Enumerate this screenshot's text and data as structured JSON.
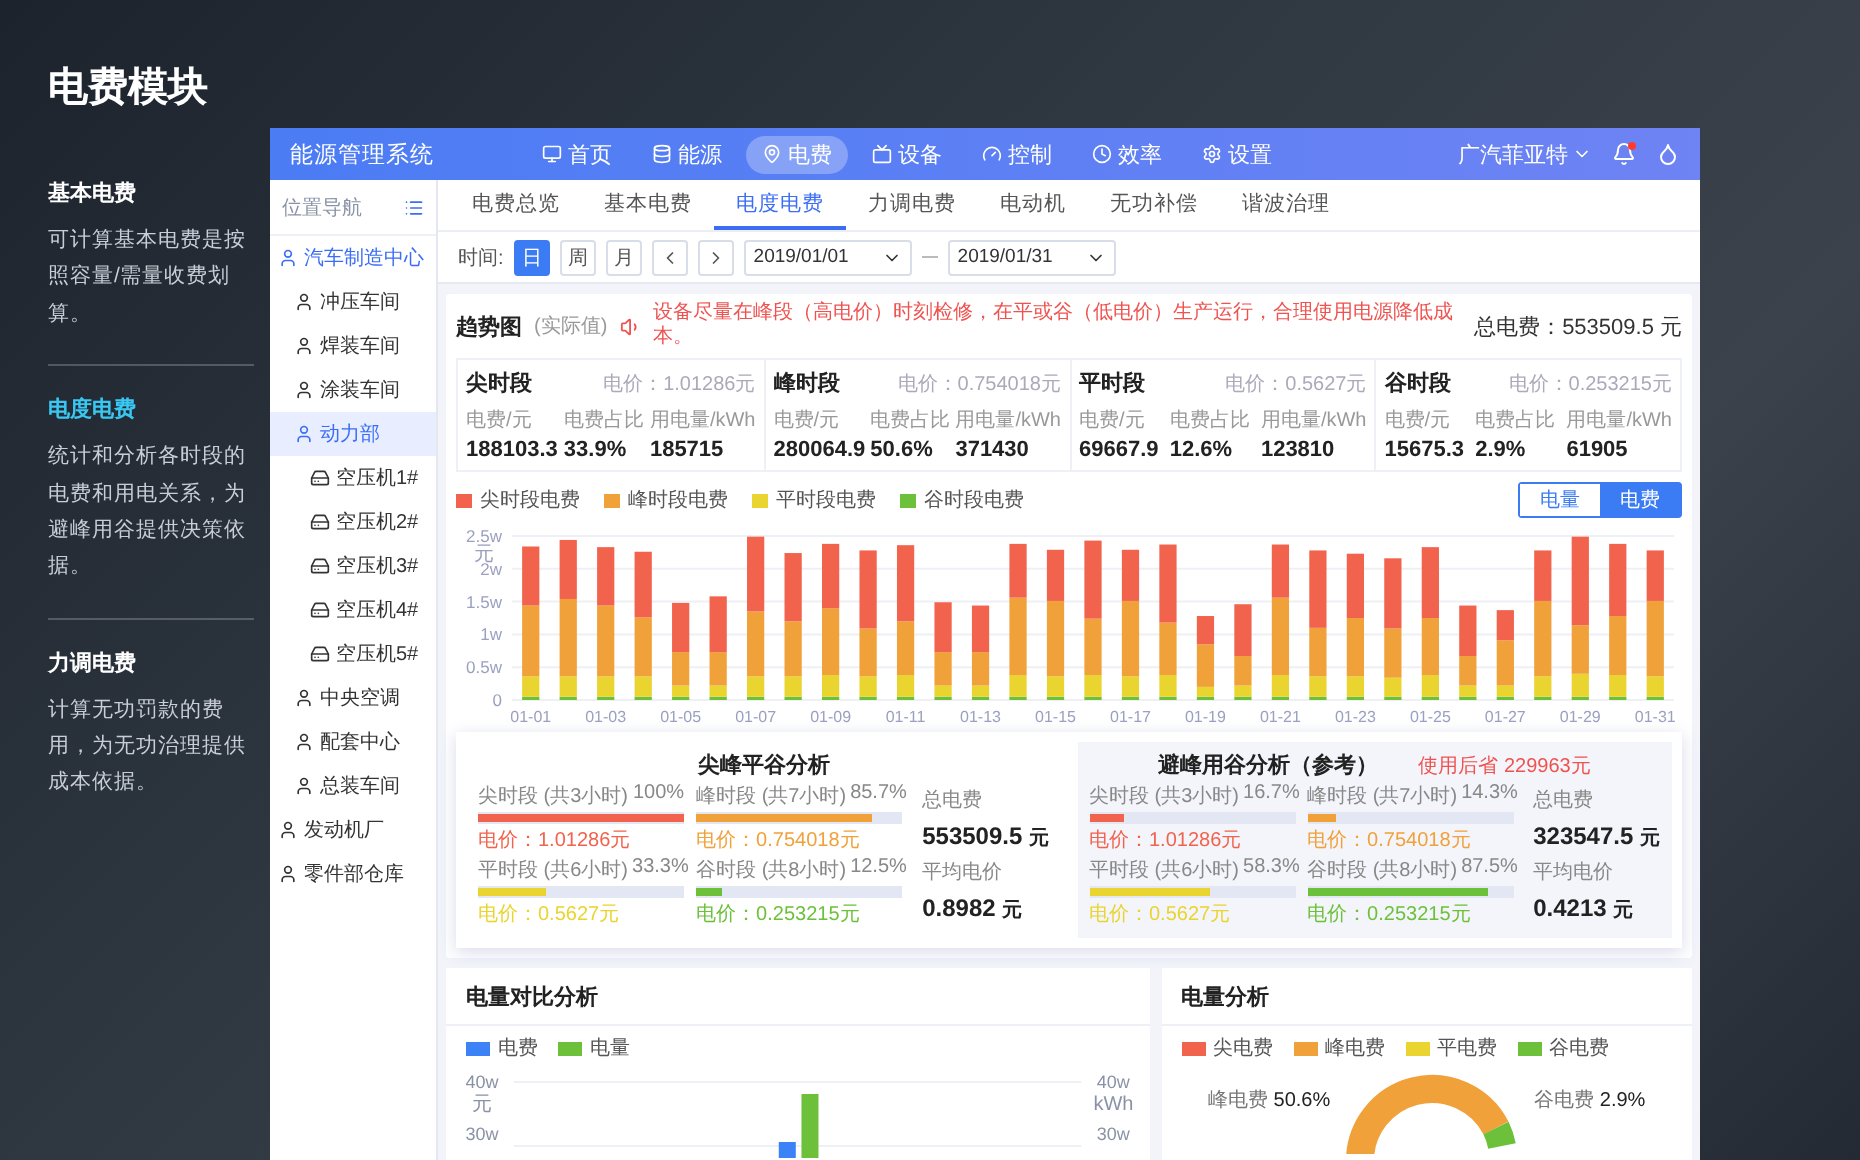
{
  "intro": {
    "title": "电费模块",
    "sections": [
      {
        "title": "基本电费",
        "text": "可计算基本电费是按照容量/需量收费划算。",
        "selected": false
      },
      {
        "title": "电度电费",
        "text": "统计和分析各时段的电费和用电关系，为避峰用谷提供决策依据。",
        "selected": true
      },
      {
        "title": "力调电费",
        "text": "计算无功罚款的费用，为无功治理提供成本依据。",
        "selected": false
      }
    ]
  },
  "app": {
    "title": "能源管理系统",
    "nav": [
      {
        "label": "首页",
        "selected": false
      },
      {
        "label": "能源",
        "selected": false
      },
      {
        "label": "电费",
        "selected": true
      },
      {
        "label": "设备",
        "selected": false
      },
      {
        "label": "控制",
        "selected": false
      },
      {
        "label": "效率",
        "selected": false
      },
      {
        "label": "设置",
        "selected": false
      }
    ],
    "company": "广汽菲亚特",
    "notification": true
  },
  "sidebar": {
    "title": "位置导航",
    "tree": [
      {
        "label": "汽车制造中心",
        "kind": "site",
        "selected": false,
        "active": true,
        "children": [
          {
            "label": "冲压车间",
            "kind": "site",
            "selected": false,
            "active": false
          },
          {
            "label": "焊装车间",
            "kind": "site",
            "selected": false,
            "active": false
          },
          {
            "label": "涂装车间",
            "kind": "site",
            "selected": false,
            "active": false
          },
          {
            "label": "动力部",
            "kind": "site",
            "selected": true,
            "active": true,
            "children": [
              {
                "label": "空压机1#",
                "kind": "device",
                "selected": false,
                "active": false
              },
              {
                "label": "空压机2#",
                "kind": "device",
                "selected": false,
                "active": false
              },
              {
                "label": "空压机3#",
                "kind": "device",
                "selected": false,
                "active": false
              },
              {
                "label": "空压机4#",
                "kind": "device",
                "selected": false,
                "active": false
              },
              {
                "label": "空压机5#",
                "kind": "device",
                "selected": false,
                "active": false
              }
            ]
          },
          {
            "label": "中央空调",
            "kind": "site",
            "selected": false,
            "active": false
          },
          {
            "label": "配套中心",
            "kind": "site",
            "selected": false,
            "active": false
          },
          {
            "label": "总装车间",
            "kind": "site",
            "selected": false,
            "active": false
          }
        ]
      },
      {
        "label": "发动机厂",
        "kind": "site",
        "selected": false,
        "active": false
      },
      {
        "label": "零件部仓库",
        "kind": "site",
        "selected": false,
        "active": false
      }
    ]
  },
  "tabs": [
    {
      "label": "电费总览",
      "selected": false
    },
    {
      "label": "基本电费",
      "selected": false
    },
    {
      "label": "电度电费",
      "selected": true
    },
    {
      "label": "力调电费",
      "selected": false
    },
    {
      "label": "电动机",
      "selected": false
    },
    {
      "label": "无功补偿",
      "selected": false
    },
    {
      "label": "谐波治理",
      "selected": false
    }
  ],
  "time": {
    "label": "时间:",
    "units": [
      {
        "label": "日",
        "selected": true
      },
      {
        "label": "周",
        "selected": false
      },
      {
        "label": "月",
        "selected": false
      }
    ],
    "start": "2019/01/01",
    "end": "2019/01/31"
  },
  "trend": {
    "title": "趋势图",
    "subtitle": "(实际值)",
    "notice": "设备尽量在峰段（高电价）时刻检修，在平或谷（低电价）生产运行，合理使用电源降低成本。",
    "total": "总电费：553509.5 元",
    "periods": [
      {
        "name": "尖时段",
        "price": "电价：1.01286元",
        "metrics": [
          {
            "label": "电费/元",
            "value": "188103.3"
          },
          {
            "label": "电费占比",
            "value": "33.9%"
          },
          {
            "label": "用电量/kWh",
            "value": "185715"
          }
        ]
      },
      {
        "name": "峰时段",
        "price": "电价：0.754018元",
        "metrics": [
          {
            "label": "电费/元",
            "value": "280064.9"
          },
          {
            "label": "电费占比",
            "value": "50.6%"
          },
          {
            "label": "用电量/kWh",
            "value": "371430"
          }
        ]
      },
      {
        "name": "平时段",
        "price": "电价：0.5627元",
        "metrics": [
          {
            "label": "电费/元",
            "value": "69667.9"
          },
          {
            "label": "电费占比",
            "value": "12.6%"
          },
          {
            "label": "用电量/kWh",
            "value": "123810"
          }
        ]
      },
      {
        "name": "谷时段",
        "price": "电价：0.253215元",
        "metrics": [
          {
            "label": "电费/元",
            "value": "15675.3"
          },
          {
            "label": "电费占比",
            "value": "2.9%"
          },
          {
            "label": "用电量/kWh",
            "value": "61905"
          }
        ]
      }
    ],
    "toggle": [
      {
        "label": "电量",
        "selected": false
      },
      {
        "label": "电费",
        "selected": true
      }
    ],
    "chart_data": {
      "type": "bar",
      "stacked": true,
      "grid": true,
      "ylabel": "元",
      "ylim": [
        0,
        2.5
      ],
      "yticks": [
        {
          "value": 0,
          "label": "0"
        },
        {
          "value": 0.5,
          "label": "0.5w"
        },
        {
          "value": 1,
          "label": "1w"
        },
        {
          "value": 1.5,
          "label": "1.5w"
        },
        {
          "value": 2,
          "label": "2w"
        },
        {
          "value": 2.5,
          "label": "2.5w"
        }
      ],
      "categories": [
        "01-01",
        null,
        "01-03",
        null,
        "01-05",
        null,
        "01-07",
        null,
        "01-09",
        null,
        "01-11",
        null,
        "01-13",
        null,
        "01-15",
        null,
        "01-17",
        null,
        "01-19",
        null,
        "01-21",
        null,
        "01-23",
        null,
        "01-25",
        null,
        "01-27",
        null,
        "01-29",
        null,
        "01-31"
      ],
      "series": [
        {
          "name": "尖时段电费",
          "color": "#f2634d",
          "values": [
            0.9,
            0.9,
            0.89,
            1.0,
            0.75,
            0.85,
            1.14,
            1.04,
            0.98,
            1.19,
            1.16,
            0.76,
            0.71,
            0.82,
            0.78,
            1.19,
            0.78,
            1.19,
            0.43,
            0.79,
            0.81,
            1.18,
            0.98,
            1.07,
            1.08,
            0.77,
            0.46,
            0.77,
            1.35,
            1.1,
            0.77
          ]
        },
        {
          "name": "峰时段电费",
          "color": "#f0a13a",
          "values": [
            1.08,
            1.18,
            1.08,
            0.9,
            0.51,
            0.51,
            0.99,
            0.84,
            1.02,
            0.73,
            0.82,
            0.51,
            0.51,
            1.18,
            1.15,
            0.86,
            1.15,
            0.8,
            0.65,
            0.45,
            1.18,
            0.74,
            0.89,
            0.75,
            0.87,
            0.45,
            0.69,
            1.15,
            0.74,
            0.9,
            1.15
          ]
        },
        {
          "name": "平时段电费",
          "color": "#e9d430",
          "values": [
            0.31,
            0.31,
            0.31,
            0.31,
            0.17,
            0.17,
            0.31,
            0.31,
            0.33,
            0.31,
            0.33,
            0.17,
            0.17,
            0.33,
            0.31,
            0.33,
            0.31,
            0.33,
            0.15,
            0.17,
            0.33,
            0.31,
            0.31,
            0.29,
            0.33,
            0.17,
            0.17,
            0.31,
            0.35,
            0.33,
            0.31
          ]
        },
        {
          "name": "谷时段电费",
          "color": "#6dc13a",
          "values": [
            0.05,
            0.05,
            0.05,
            0.05,
            0.05,
            0.05,
            0.05,
            0.05,
            0.05,
            0.05,
            0.05,
            0.05,
            0.05,
            0.05,
            0.05,
            0.05,
            0.05,
            0.05,
            0.05,
            0.05,
            0.05,
            0.05,
            0.05,
            0.05,
            0.05,
            0.05,
            0.05,
            0.05,
            0.05,
            0.05,
            0.05
          ]
        }
      ]
    },
    "analysis": [
      {
        "title": "尖峰平谷分析",
        "items": [
          {
            "name": "尖时段",
            "hours": "(共3小时)",
            "percent": "100%",
            "price": "电价：1.01286元",
            "level": 1,
            "color": "#f2634d"
          },
          {
            "name": "峰时段",
            "hours": "(共7小时)",
            "percent": "85.7%",
            "price": "电价：0.754018元",
            "level": 0.857,
            "color": "#f0a13a"
          },
          {
            "name": "平时段",
            "hours": "(共6小时)",
            "percent": "33.3%",
            "price": "电价：0.5627元",
            "level": 0.333,
            "color": "#e9d430"
          },
          {
            "name": "谷时段",
            "hours": "(共8小时)",
            "percent": "12.5%",
            "price": "电价：0.253215元",
            "level": 0.125,
            "color": "#6dc13a"
          }
        ],
        "totals": [
          {
            "label": "总电费",
            "value": "553509.5",
            "unit": "元"
          },
          {
            "label": "平均电价",
            "value": "0.8982",
            "unit": "元"
          }
        ]
      },
      {
        "title": "避峰用谷分析（参考）",
        "saving": "使用后省 229963元",
        "items": [
          {
            "name": "尖时段",
            "hours": "(共3小时)",
            "percent": "16.7%",
            "price": "电价：1.01286元",
            "level": 0.167,
            "color": "#f2634d"
          },
          {
            "name": "峰时段",
            "hours": "(共7小时)",
            "percent": "14.3%",
            "price": "电价：0.754018元",
            "level": 0.143,
            "color": "#f0a13a"
          },
          {
            "name": "平时段",
            "hours": "(共6小时)",
            "percent": "58.3%",
            "price": "电价：0.5627元",
            "level": 0.583,
            "color": "#e9d430"
          },
          {
            "name": "谷时段",
            "hours": "(共8小时)",
            "percent": "87.5%",
            "price": "电价：0.253215元",
            "level": 0.875,
            "color": "#6dc13a"
          }
        ],
        "totals": [
          {
            "label": "总电费",
            "value": "323547.5",
            "unit": "元"
          },
          {
            "label": "平均电价",
            "value": "0.4213",
            "unit": "元"
          }
        ]
      }
    ]
  },
  "compare": {
    "title": "电量对比分析",
    "legend": [
      {
        "label": "电费",
        "color": "#3b82f6"
      },
      {
        "label": "电量",
        "color": "#6dc13a"
      }
    ],
    "left_axis": {
      "tick": "40w",
      "unit": "元",
      "next": "30w"
    },
    "right_axis": {
      "tick": "40w",
      "unit": "kWh",
      "next": "30w"
    }
  },
  "energy": {
    "title": "电量分析",
    "legend": [
      {
        "label": "尖电费",
        "color": "#f2634d"
      },
      {
        "label": "峰电费",
        "color": "#f0a13a"
      },
      {
        "label": "平电费",
        "color": "#e9d430"
      },
      {
        "label": "谷电费",
        "color": "#6dc13a"
      }
    ],
    "labels": [
      {
        "name": "峰电费",
        "percent": "50.6%"
      },
      {
        "name": "谷电费",
        "percent": "2.9%"
      }
    ]
  }
}
